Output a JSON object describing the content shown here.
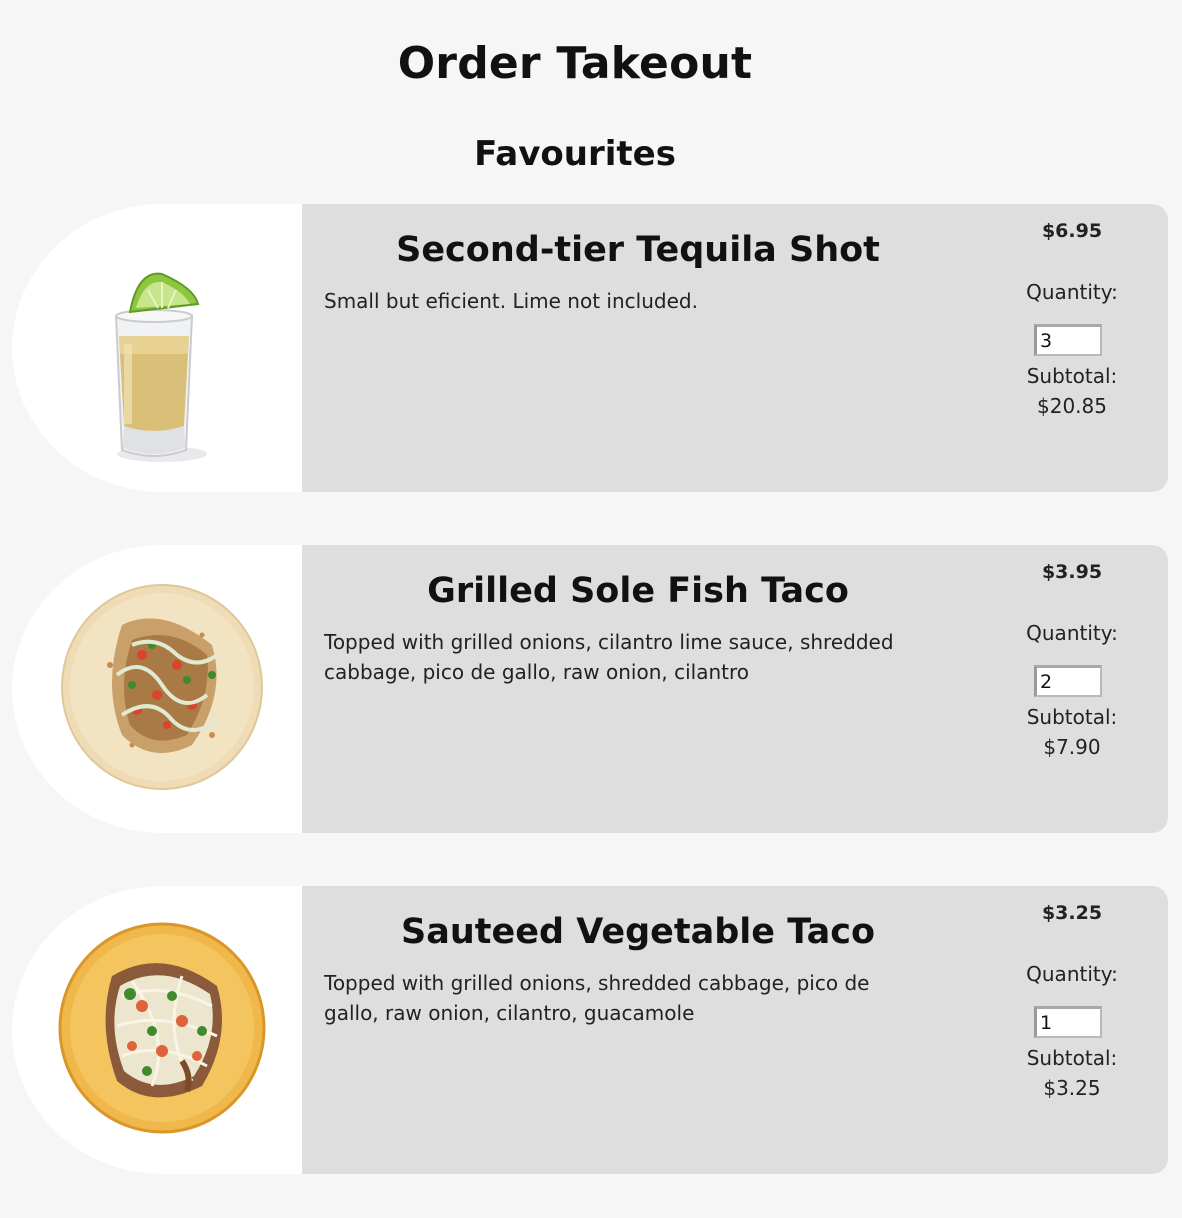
{
  "page": {
    "title": "Order Takeout",
    "section_title": "Favourites"
  },
  "items": [
    {
      "name": "Second-tier Tequila Shot",
      "description": "Small but eficient. Lime not included.",
      "price": "$6.95",
      "quantity_label": "Quantity:",
      "quantity": "3",
      "subtotal_label": "Subtotal:",
      "subtotal": "$20.85",
      "image_icon": "tequila-shot-image"
    },
    {
      "name": "Grilled Sole Fish Taco",
      "description": "Topped with grilled onions, cilantro lime sauce, shredded cabbage, pico de gallo, raw onion, cilantro",
      "price": "$3.95",
      "quantity_label": "Quantity:",
      "quantity": "2",
      "subtotal_label": "Subtotal:",
      "subtotal": "$7.90",
      "image_icon": "fish-taco-image"
    },
    {
      "name": "Sauteed Vegetable Taco",
      "description": "Topped with grilled onions, shredded cabbage, pico de gallo, raw onion, cilantro, guacamole",
      "price": "$3.25",
      "quantity_label": "Quantity:",
      "quantity": "1",
      "subtotal_label": "Subtotal:",
      "subtotal": "$3.25",
      "image_icon": "vegetable-taco-image"
    }
  ],
  "colors": {
    "background": "#f6f6f6",
    "card": "#dedede",
    "image_panel": "#ffffff",
    "text": "#111111"
  }
}
